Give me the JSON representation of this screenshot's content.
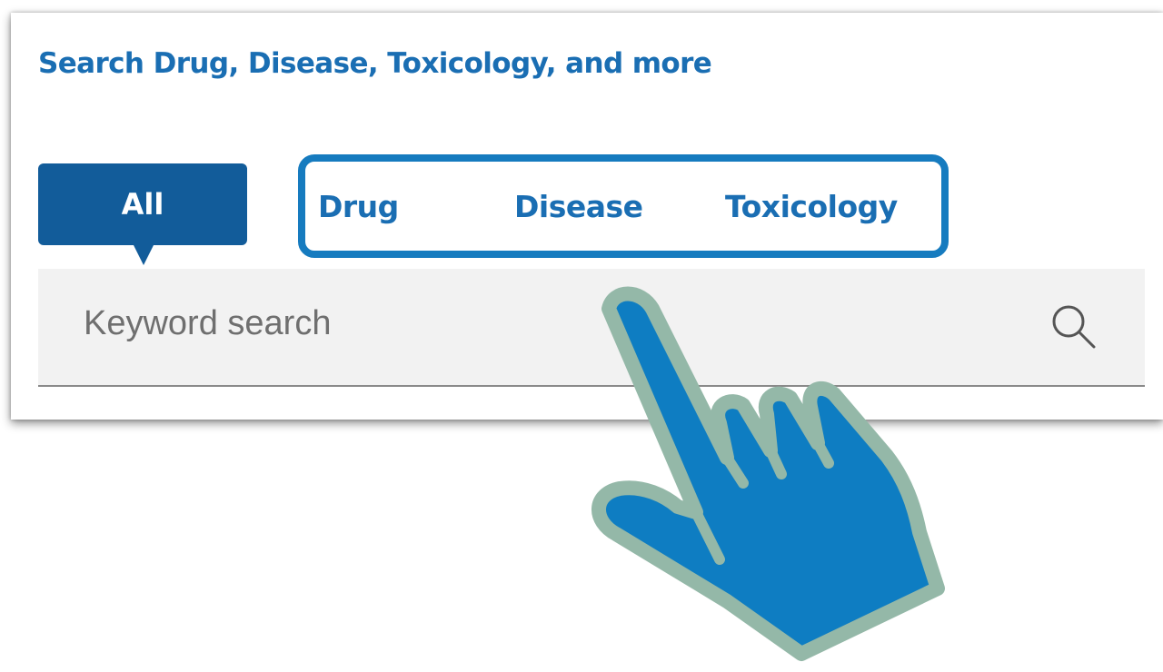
{
  "card": {
    "title": "Search Drug, Disease, Toxicology, and more"
  },
  "tabs": {
    "all": "All",
    "drug": "Drug",
    "disease": "Disease",
    "toxicology": "Toxicology",
    "active": "All"
  },
  "search": {
    "placeholder": "Keyword search",
    "value": "",
    "icon": "search-icon"
  },
  "overlay": {
    "icon": "pointing-hand-icon"
  },
  "colors": {
    "title_blue": "#1a6eb3",
    "active_tab_bg": "#125c9a",
    "highlight_border": "#167bbf",
    "hand_fill": "#0e7dc2",
    "hand_outline": "#94b8a8",
    "search_bg": "#f2f2f2"
  }
}
